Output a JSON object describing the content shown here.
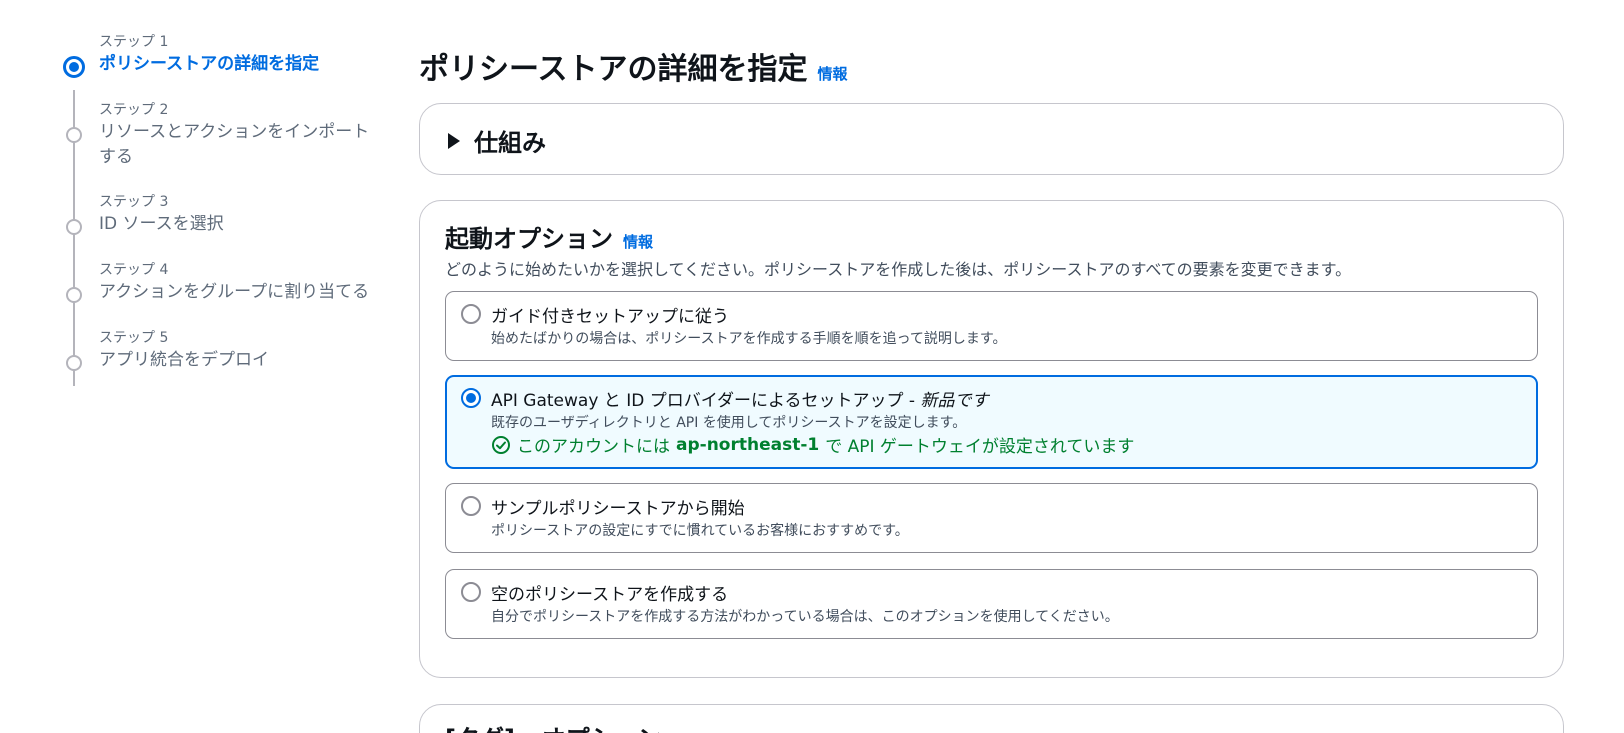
{
  "stepper": {
    "steps": [
      {
        "small": "ステップ 1",
        "label": "ポリシーストアの詳細を指定"
      },
      {
        "small": "ステップ 2",
        "label": "リソースとアクションをインポート",
        "label2": "する"
      },
      {
        "small": "ステップ 3",
        "label": "ID ソースを選択"
      },
      {
        "small": "ステップ 4",
        "label": "アクションをグループに割り当てる"
      },
      {
        "small": "ステップ 5",
        "label": "アプリ統合をデプロイ"
      }
    ]
  },
  "header": {
    "title": "ポリシーストアの詳細を指定",
    "info": "情報"
  },
  "how": {
    "title": "仕組み"
  },
  "launch": {
    "title": "起動オプション",
    "info": "情報",
    "description": "どのように始めたいかを選択してください。ポリシーストアを作成した後は、ポリシーストアのすべての要素を変更できます。",
    "options": [
      {
        "title": "ガイド付きセットアップに従う",
        "desc": "始めたばかりの場合は、ポリシーストアを作成する手順を順を追って説明します。"
      },
      {
        "title": "API Gateway と ID プロバイダーによるセットアップ - ",
        "title_em": "新品です",
        "desc": "既存のユーザディレクトリと API を使用してポリシーストアを設定します。",
        "status_prefix": "このアカウントには ",
        "status_region": "ap-northeast-1",
        "status_suffix": " で API ゲートウェイが設定されています"
      },
      {
        "title": "サンプルポリシーストアから開始",
        "desc": "ポリシーストアの設定にすでに慣れているお客様におすすめです。"
      },
      {
        "title": "空のポリシーストアを作成する",
        "desc": "自分でポリシーストアを作成する方法がわかっている場合は、このオプションを使用してください。"
      }
    ],
    "selected_index": 1
  },
  "tags": {
    "title": "[タグ] - オプション"
  },
  "colors": {
    "accent": "#006ce0",
    "success": "#00802f",
    "selected_bg": "#f0fbff"
  }
}
